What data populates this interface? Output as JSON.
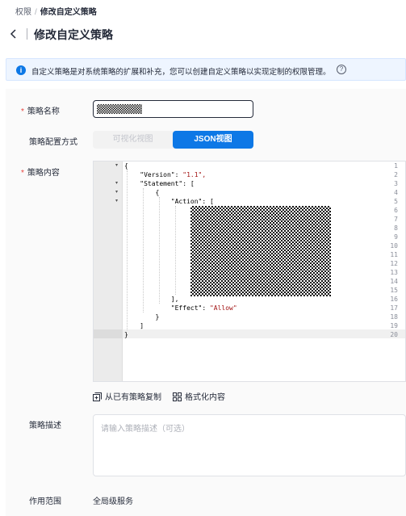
{
  "breadcrumb": {
    "parent": "权限",
    "separator": "/",
    "current": "修改自定义策略"
  },
  "header": {
    "title": "修改自定义策略"
  },
  "notice": {
    "text": "自定义策略是对系统策略的扩展和补充，您可以创建自定义策略以实现定制的权限管理。",
    "info_icon": "i",
    "help_icon": "?"
  },
  "form": {
    "name": {
      "label": "策略名称",
      "required_mark": "*"
    },
    "config_mode": {
      "label": "策略配置方式",
      "options": [
        "可视化视图",
        "JSON视图"
      ],
      "selected": "JSON视图"
    },
    "content": {
      "label": "策略内容",
      "required_mark": "*",
      "line_numbers": [
        "1",
        "2",
        "3",
        "4",
        "5",
        "6",
        "7",
        "8",
        "9",
        "10",
        "11",
        "12",
        "13",
        "14",
        "15",
        "16",
        "17",
        "18",
        "19",
        "20"
      ],
      "code_lines": [
        "{",
        "    \"Version\": ",
        "    \"Statement\": [",
        "        {",
        "            \"Action\": [",
        "            ],",
        "            \"Effect\": ",
        "        }",
        "    ]",
        "}"
      ],
      "version_value": "\"1.1\",",
      "effect_value": "\"Allow\"",
      "copy_action": "从已有策略复制",
      "format_action": "格式化内容"
    },
    "description": {
      "label": "策略描述",
      "placeholder": "请输入策略描述（可选）",
      "value": ""
    },
    "scope": {
      "label": "作用范围",
      "value": "全局级服务"
    }
  },
  "colors": {
    "primary": "#0d78e6",
    "required": "#e8433d",
    "notice_bg": "#eef5ff"
  }
}
